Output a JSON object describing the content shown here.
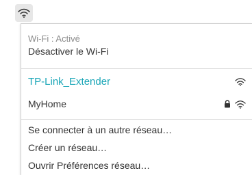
{
  "menubar": {
    "wifi_icon": "wifi-icon"
  },
  "wifi": {
    "status": "Wi-Fi : Activé",
    "toggle_label": "Désactiver le Wi-Fi"
  },
  "networks": [
    {
      "name": "TP-Link_Extender",
      "selected": true,
      "locked": false,
      "accent": "#1aa6b7"
    },
    {
      "name": "MyHome",
      "selected": false,
      "locked": true
    }
  ],
  "actions": {
    "join_other": "Se connecter à un autre réseau…",
    "create": "Créer un réseau…",
    "prefs": "Ouvrir Préférences réseau…"
  }
}
